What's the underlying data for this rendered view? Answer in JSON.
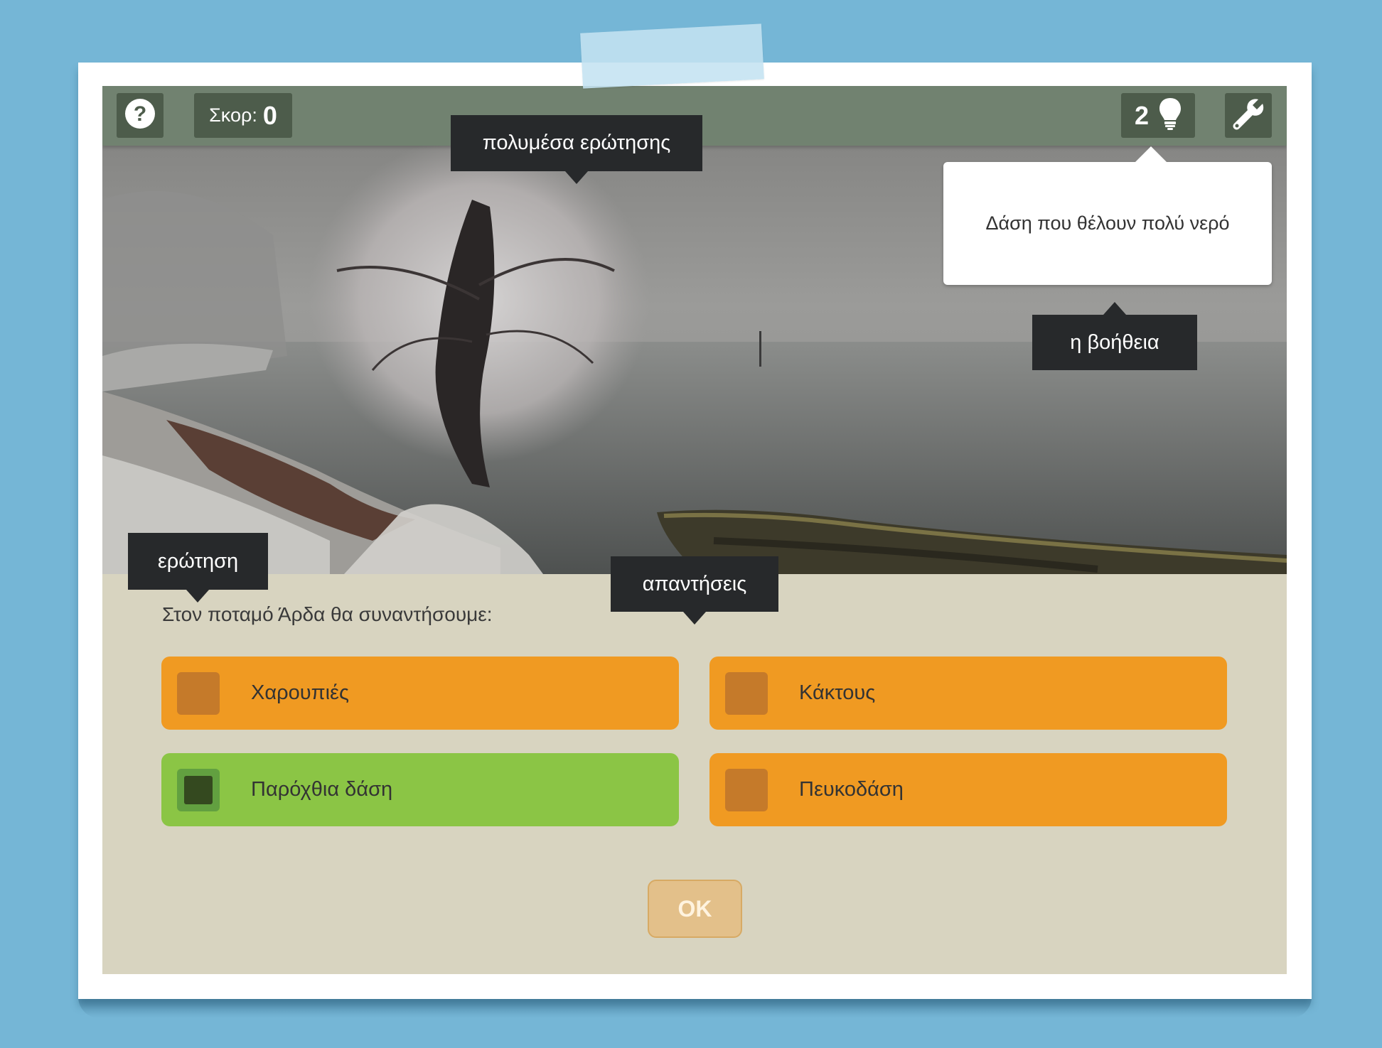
{
  "topbar": {
    "help_icon": "question-circle-icon",
    "score_label": "Σκορ:",
    "score_value": "0",
    "hints_remaining": "2",
    "hint_icon": "lightbulb-icon",
    "tools_icon": "wrench-icon"
  },
  "hint_popup": {
    "text": "Δάση που θέλουν πολύ νερό"
  },
  "tooltips": {
    "media": "πολυμέσα ερώτησης",
    "help": "η βοήθεια",
    "question": "ερώτηση",
    "answers": "απαντήσεις"
  },
  "quiz": {
    "question": "Στον ποταμό Άρδα θα συναντήσουμε:",
    "answers": [
      {
        "label": "Χαρουπιές",
        "selected": false,
        "color": "#f09a22"
      },
      {
        "label": "Κάκτους",
        "selected": false,
        "color": "#f09a22"
      },
      {
        "label": "Παρόχθια δάση",
        "selected": true,
        "color": "#8bc545"
      },
      {
        "label": "Πευκοδάση",
        "selected": false,
        "color": "#f09a22"
      }
    ],
    "ok_label": "OK"
  },
  "colors": {
    "background": "#75b6d6",
    "topbar": "#718270",
    "stage": "#d8d4c0",
    "answer_default": "#f09a22",
    "answer_selected": "#8bc545",
    "ok_button": "#e3c08a"
  }
}
